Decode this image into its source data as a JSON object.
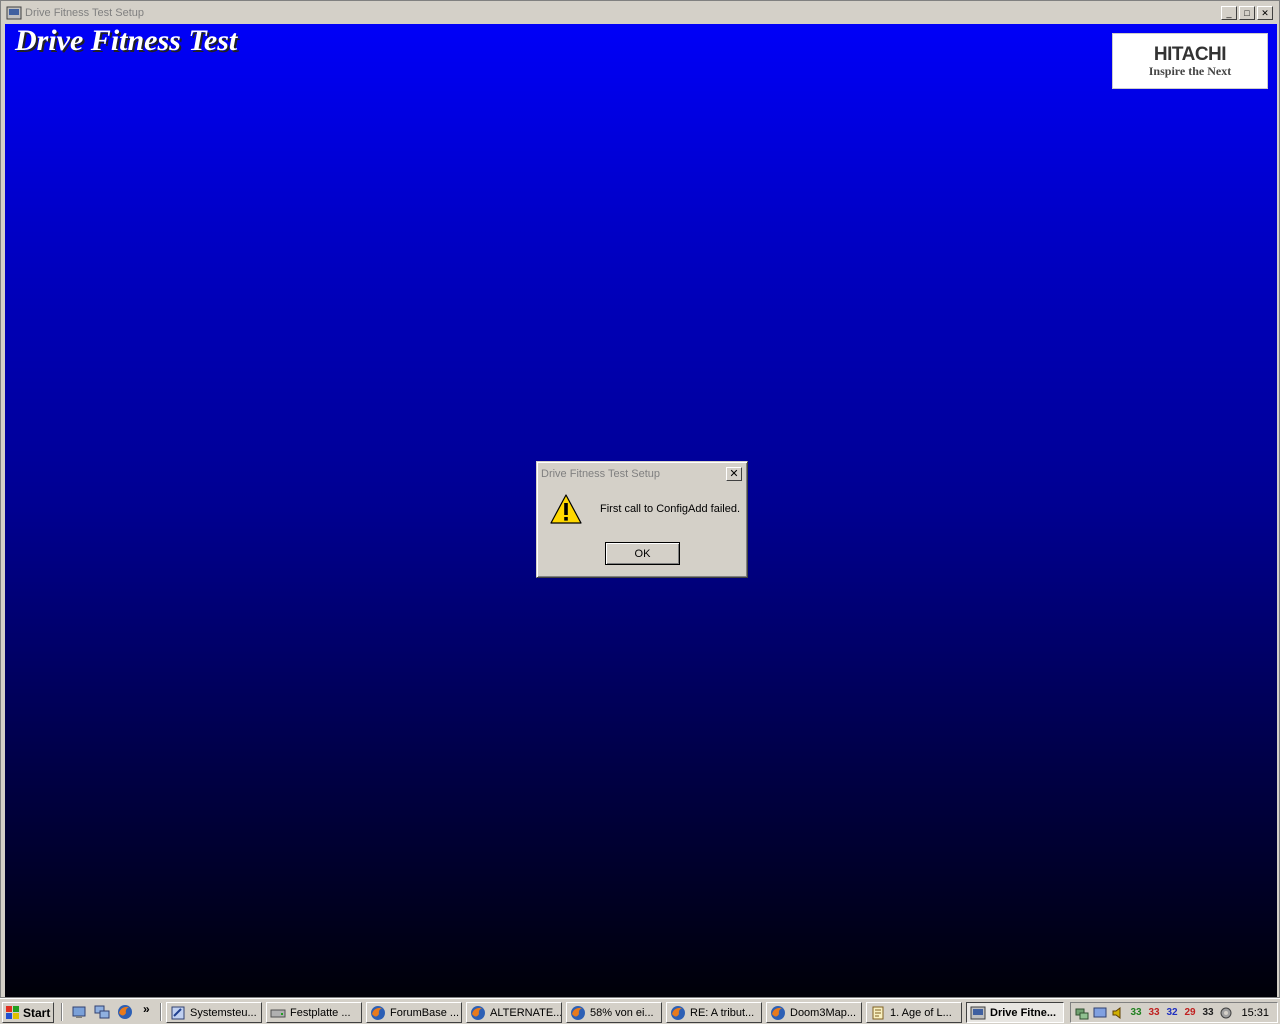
{
  "window": {
    "title": "Drive Fitness Test Setup",
    "minimize_glyph": "_",
    "maximize_glyph": "□",
    "close_glyph": "✕"
  },
  "app": {
    "heading": "Drive Fitness Test",
    "logo_brand": "HITACHI",
    "logo_tagline": "Inspire the Next"
  },
  "dialog": {
    "title": "Drive Fitness Test Setup",
    "close_glyph": "✕",
    "message": "First call to ConfigAdd failed.",
    "ok_label": "OK",
    "icon": "warning-icon"
  },
  "taskbar": {
    "start_label": "Start",
    "quick_launch_more": "»",
    "tasks": [
      {
        "label": "Systemsteu...",
        "icon": "control-panel-icon"
      },
      {
        "label": "Festplatte ...",
        "icon": "drive-icon"
      },
      {
        "label": "ForumBase ...",
        "icon": "firefox-icon"
      },
      {
        "label": "ALTERNATE...",
        "icon": "firefox-icon"
      },
      {
        "label": "58% von ei...",
        "icon": "firefox-icon"
      },
      {
        "label": "RE: A tribut...",
        "icon": "firefox-icon"
      },
      {
        "label": "Doom3Map...",
        "icon": "firefox-icon"
      },
      {
        "label": "1. Age of L...",
        "icon": "notepad-icon"
      },
      {
        "label": "Drive Fitne...",
        "icon": "drive-fitness-icon",
        "active": true
      }
    ],
    "tray_labels": [
      "33",
      "33",
      "32",
      "29",
      "33"
    ],
    "clock": "15:31"
  }
}
